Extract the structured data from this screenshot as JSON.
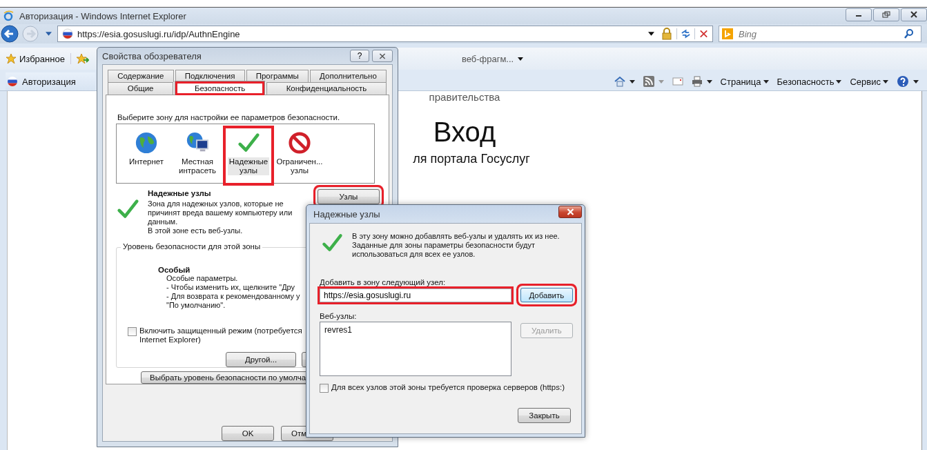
{
  "window": {
    "title": "Авторизация - Windows Internet Explorer"
  },
  "address_bar": {
    "url": "https://esia.gosuslugi.ru/idp/AuthnEngine"
  },
  "search_field": {
    "placeholder": "Bing"
  },
  "favorites_bar": {
    "favorites": "Избранное",
    "web_slice": "веб-фрагм..."
  },
  "tab": {
    "title": "Авторизация"
  },
  "command_bar": {
    "menus": [
      "Страница",
      "Безопасность",
      "Сервис"
    ]
  },
  "page": {
    "top_text": "правительства",
    "heading": "Вход",
    "subtitle": "ля портала Госуслуг"
  },
  "internet_options": {
    "title": "Свойства обозревателя",
    "help": "?",
    "tab_rows": [
      [
        {
          "label": "Содержание",
          "selected": false,
          "highlighted": false
        },
        {
          "label": "Подключения",
          "selected": false,
          "highlighted": false
        },
        {
          "label": "Программы",
          "selected": false,
          "highlighted": false
        },
        {
          "label": "Дополнительно",
          "selected": false,
          "highlighted": false
        }
      ],
      [
        {
          "label": "Общие",
          "selected": false,
          "highlighted": false
        },
        {
          "label": "Безопасность",
          "selected": true,
          "highlighted": true
        },
        {
          "label": "Конфиденциальность",
          "selected": false,
          "highlighted": false
        }
      ]
    ],
    "zone_prompt": "Выберите зону для настройки ее параметров безопасности.",
    "zones": [
      {
        "kind": "internet",
        "label": "Интернет",
        "selected": false,
        "highlighted": false
      },
      {
        "kind": "intranet",
        "label": "Местная\nинтрасеть",
        "selected": false,
        "highlighted": false
      },
      {
        "kind": "trusted",
        "label": "Надежные\nузлы",
        "selected": true,
        "highlighted": true
      },
      {
        "kind": "restricted",
        "label": "Ограничен...\nузлы",
        "selected": false,
        "highlighted": false
      }
    ],
    "zone_name": "Надежные узлы",
    "zone_description": "Зона для надежных узлов, которые не\nпричинят вреда вашему компьютеру или\nданным.\nВ этой зоне есть веб-узлы.",
    "sites_button": {
      "label": "Узлы",
      "highlighted": true
    },
    "level_group": {
      "legend": "Уровень безопасности для этой зоны",
      "level": "Особый",
      "lines": [
        "Особые параметры.",
        "- Чтобы изменить их, щелкните \"Дру",
        "- Для возврата к рекомендованному у",
        "\"По умолчанию\"."
      ]
    },
    "protected_mode": {
      "label": "Включить защищенный режим (потребуется\nInternet Explorer)",
      "checked": false
    },
    "custom_button": "Другой...",
    "default_button": "Выбрать уровень безопасности по умолча",
    "footer_buttons": [
      "OK",
      "Отм"
    ]
  },
  "trusted_sites": {
    "title": "Надежные узлы",
    "info": "В эту зону можно добавлять веб-узлы и удалять их из нее.\nЗаданные для зоны параметры безопасности будут\nиспользоваться для всех ее узлов.",
    "add_label": "Добавить в зону следующий узел:",
    "url_field": {
      "value": "https://esia.gosuslugi.ru",
      "highlighted": true
    },
    "add_button": {
      "label": "Добавить",
      "highlighted": true
    },
    "sites_label": "Веб-узлы:",
    "sites": [
      "revres1"
    ],
    "remove_button": {
      "label": "Удалить",
      "disabled": true
    },
    "require_https": {
      "label": "Для всех узлов этой зоны требуется проверка серверов (https:)",
      "checked": false
    },
    "close_button": "Закрыть"
  }
}
